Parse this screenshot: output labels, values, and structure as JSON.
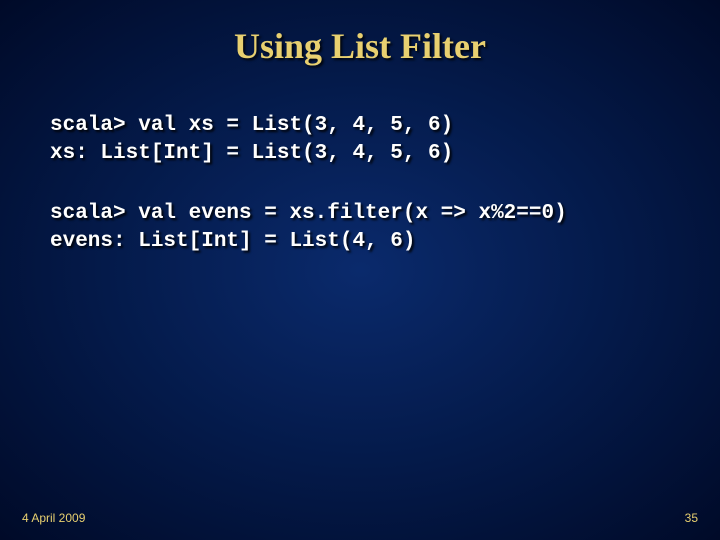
{
  "title": "Using List Filter",
  "code_block1_line1": "scala> val xs = List(3, 4, 5, 6)",
  "code_block1_line2": "xs: List[Int] = List(3, 4, 5, 6)",
  "code_block2_line1": "scala> val evens = xs.filter(x => x%2==0)",
  "code_block2_line2": "evens: List[Int] = List(4, 6)",
  "footer_date": "4 April 2009",
  "slide_number": "35"
}
